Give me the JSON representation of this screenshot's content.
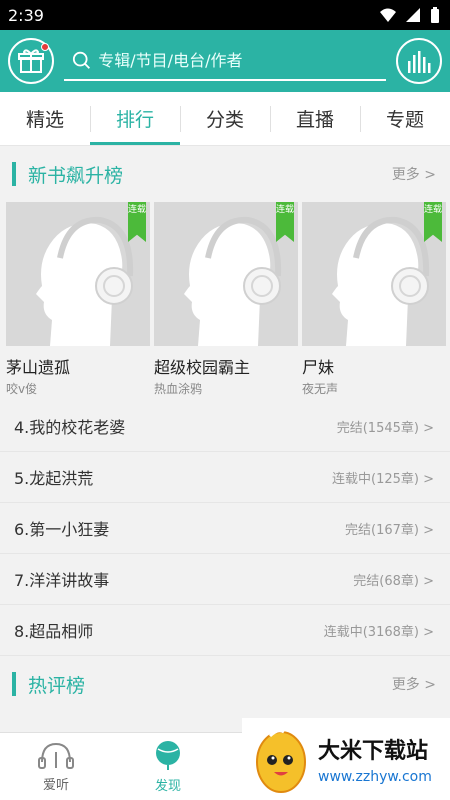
{
  "status": {
    "time": "2:39"
  },
  "search": {
    "placeholder": "专辑/节目/电台/作者"
  },
  "tabs": [
    {
      "label": "精选"
    },
    {
      "label": "排行"
    },
    {
      "label": "分类"
    },
    {
      "label": "直播"
    },
    {
      "label": "专题"
    }
  ],
  "sections": {
    "new_books": {
      "title": "新书飙升榜",
      "more": "更多 >"
    },
    "hot_reviews": {
      "title": "热评榜",
      "more": "更多 >"
    }
  },
  "top_books": [
    {
      "title": "茅山遗孤",
      "author": "咬v俊",
      "badge": "连载"
    },
    {
      "title": "超级校园霸主",
      "author": "热血涂鸦",
      "badge": "连载"
    },
    {
      "title": "尸妹",
      "author": "夜无声",
      "badge": "连载"
    }
  ],
  "rank_list": [
    {
      "title": "4.我的校花老婆",
      "status": "完结(1545章) >"
    },
    {
      "title": "5.龙起洪荒",
      "status": "连载中(125章) >"
    },
    {
      "title": "6.第一小狂妻",
      "status": "完结(167章) >"
    },
    {
      "title": "7.洋洋讲故事",
      "status": "完结(68章) >"
    },
    {
      "title": "8.超品相师",
      "status": "连载中(3168章) >"
    }
  ],
  "bottom_nav": [
    {
      "label": "爱听",
      "icon": "headphones-icon"
    },
    {
      "label": "发现",
      "icon": "globe-icon"
    }
  ],
  "watermark": {
    "name": "大米下载站",
    "url": "www.zzhyw.com"
  },
  "colors": {
    "accent": "#2bb3a4",
    "ribbon": "#4cba3a",
    "badge_dot": "#e43a3a"
  }
}
